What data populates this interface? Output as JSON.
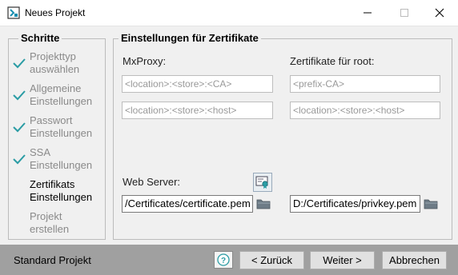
{
  "window": {
    "title": "Neues Projekt"
  },
  "steps": {
    "title": "Schritte",
    "items": [
      {
        "line1": "Projekttyp",
        "line2": "auswählen",
        "done": true
      },
      {
        "line1": "Allgemeine",
        "line2": "Einstellungen",
        "done": true
      },
      {
        "line1": "Passwort",
        "line2": "Einstellungen",
        "done": true
      },
      {
        "line1": "SSA",
        "line2": "Einstellungen",
        "done": true
      },
      {
        "line1": "Zertifikats",
        "line2": "Einstellungen",
        "done": false,
        "current": true
      },
      {
        "line1": "Projekt",
        "line2": "erstellen",
        "done": false
      }
    ]
  },
  "certificates": {
    "title": "Einstellungen für Zertifikate",
    "mxproxy": {
      "label": "MxProxy:",
      "field1_placeholder": "<location>:<store>:<CA>",
      "field2_placeholder": "<location>:<store>:<host>"
    },
    "root": {
      "label": "Zertifikate für root:",
      "field1_placeholder": "<prefix-CA>",
      "field2_placeholder": "<location>:<store>:<host>"
    },
    "webserver": {
      "label": "Web Server:",
      "cert_value": "/Certificates/certificate.pem",
      "key_value": "D:/Certificates/privkey.pem"
    }
  },
  "footer": {
    "project_type": "Standard Projekt",
    "help_label": "?",
    "back_label": "< Zurück",
    "next_label": "Weiter >",
    "cancel_label": "Abbrechen"
  },
  "colors": {
    "check": "#2a9ca4",
    "disabled_text": "#8a8a8a",
    "bottom_bar": "#a0a0a0"
  }
}
